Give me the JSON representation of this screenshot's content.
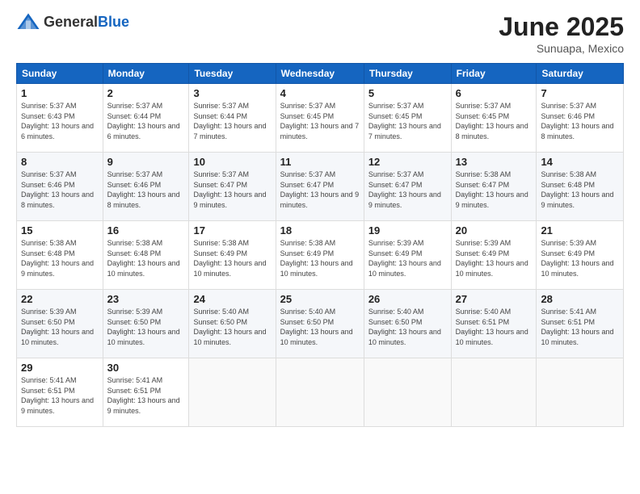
{
  "header": {
    "logo_general": "General",
    "logo_blue": "Blue",
    "title": "June 2025",
    "location": "Sunuapa, Mexico"
  },
  "days_of_week": [
    "Sunday",
    "Monday",
    "Tuesday",
    "Wednesday",
    "Thursday",
    "Friday",
    "Saturday"
  ],
  "weeks": [
    [
      {
        "day": "1",
        "sunrise": "5:37 AM",
        "sunset": "6:43 PM",
        "daylight": "13 hours and 6 minutes."
      },
      {
        "day": "2",
        "sunrise": "5:37 AM",
        "sunset": "6:44 PM",
        "daylight": "13 hours and 6 minutes."
      },
      {
        "day": "3",
        "sunrise": "5:37 AM",
        "sunset": "6:44 PM",
        "daylight": "13 hours and 7 minutes."
      },
      {
        "day": "4",
        "sunrise": "5:37 AM",
        "sunset": "6:45 PM",
        "daylight": "13 hours and 7 minutes."
      },
      {
        "day": "5",
        "sunrise": "5:37 AM",
        "sunset": "6:45 PM",
        "daylight": "13 hours and 7 minutes."
      },
      {
        "day": "6",
        "sunrise": "5:37 AM",
        "sunset": "6:45 PM",
        "daylight": "13 hours and 8 minutes."
      },
      {
        "day": "7",
        "sunrise": "5:37 AM",
        "sunset": "6:46 PM",
        "daylight": "13 hours and 8 minutes."
      }
    ],
    [
      {
        "day": "8",
        "sunrise": "5:37 AM",
        "sunset": "6:46 PM",
        "daylight": "13 hours and 8 minutes."
      },
      {
        "day": "9",
        "sunrise": "5:37 AM",
        "sunset": "6:46 PM",
        "daylight": "13 hours and 8 minutes."
      },
      {
        "day": "10",
        "sunrise": "5:37 AM",
        "sunset": "6:47 PM",
        "daylight": "13 hours and 9 minutes."
      },
      {
        "day": "11",
        "sunrise": "5:37 AM",
        "sunset": "6:47 PM",
        "daylight": "13 hours and 9 minutes."
      },
      {
        "day": "12",
        "sunrise": "5:37 AM",
        "sunset": "6:47 PM",
        "daylight": "13 hours and 9 minutes."
      },
      {
        "day": "13",
        "sunrise": "5:38 AM",
        "sunset": "6:47 PM",
        "daylight": "13 hours and 9 minutes."
      },
      {
        "day": "14",
        "sunrise": "5:38 AM",
        "sunset": "6:48 PM",
        "daylight": "13 hours and 9 minutes."
      }
    ],
    [
      {
        "day": "15",
        "sunrise": "5:38 AM",
        "sunset": "6:48 PM",
        "daylight": "13 hours and 9 minutes."
      },
      {
        "day": "16",
        "sunrise": "5:38 AM",
        "sunset": "6:48 PM",
        "daylight": "13 hours and 10 minutes."
      },
      {
        "day": "17",
        "sunrise": "5:38 AM",
        "sunset": "6:49 PM",
        "daylight": "13 hours and 10 minutes."
      },
      {
        "day": "18",
        "sunrise": "5:38 AM",
        "sunset": "6:49 PM",
        "daylight": "13 hours and 10 minutes."
      },
      {
        "day": "19",
        "sunrise": "5:39 AM",
        "sunset": "6:49 PM",
        "daylight": "13 hours and 10 minutes."
      },
      {
        "day": "20",
        "sunrise": "5:39 AM",
        "sunset": "6:49 PM",
        "daylight": "13 hours and 10 minutes."
      },
      {
        "day": "21",
        "sunrise": "5:39 AM",
        "sunset": "6:49 PM",
        "daylight": "13 hours and 10 minutes."
      }
    ],
    [
      {
        "day": "22",
        "sunrise": "5:39 AM",
        "sunset": "6:50 PM",
        "daylight": "13 hours and 10 minutes."
      },
      {
        "day": "23",
        "sunrise": "5:39 AM",
        "sunset": "6:50 PM",
        "daylight": "13 hours and 10 minutes."
      },
      {
        "day": "24",
        "sunrise": "5:40 AM",
        "sunset": "6:50 PM",
        "daylight": "13 hours and 10 minutes."
      },
      {
        "day": "25",
        "sunrise": "5:40 AM",
        "sunset": "6:50 PM",
        "daylight": "13 hours and 10 minutes."
      },
      {
        "day": "26",
        "sunrise": "5:40 AM",
        "sunset": "6:50 PM",
        "daylight": "13 hours and 10 minutes."
      },
      {
        "day": "27",
        "sunrise": "5:40 AM",
        "sunset": "6:51 PM",
        "daylight": "13 hours and 10 minutes."
      },
      {
        "day": "28",
        "sunrise": "5:41 AM",
        "sunset": "6:51 PM",
        "daylight": "13 hours and 10 minutes."
      }
    ],
    [
      {
        "day": "29",
        "sunrise": "5:41 AM",
        "sunset": "6:51 PM",
        "daylight": "13 hours and 9 minutes."
      },
      {
        "day": "30",
        "sunrise": "5:41 AM",
        "sunset": "6:51 PM",
        "daylight": "13 hours and 9 minutes."
      },
      null,
      null,
      null,
      null,
      null
    ]
  ]
}
